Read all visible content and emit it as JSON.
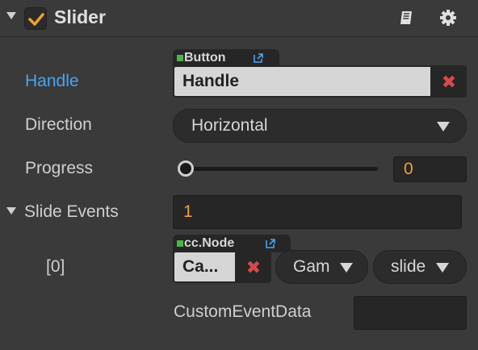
{
  "component": {
    "title": "Slider",
    "enabled": true
  },
  "handle": {
    "label": "Handle",
    "type_tag": "Button",
    "value": "Handle",
    "clear_icon": "✖"
  },
  "direction": {
    "label": "Direction",
    "value": "Horizontal"
  },
  "progress": {
    "label": "Progress",
    "value": "0",
    "fraction": 0
  },
  "slide_events": {
    "label": "Slide Events",
    "count": "1",
    "items": [
      {
        "index_label": "[0]",
        "type_tag": "cc.Node",
        "target": "Ca...",
        "clear_icon": "✖",
        "component": "Gam",
        "handler": "slide",
        "custom_event_data_label": "CustomEventData",
        "custom_event_data": ""
      }
    ]
  }
}
